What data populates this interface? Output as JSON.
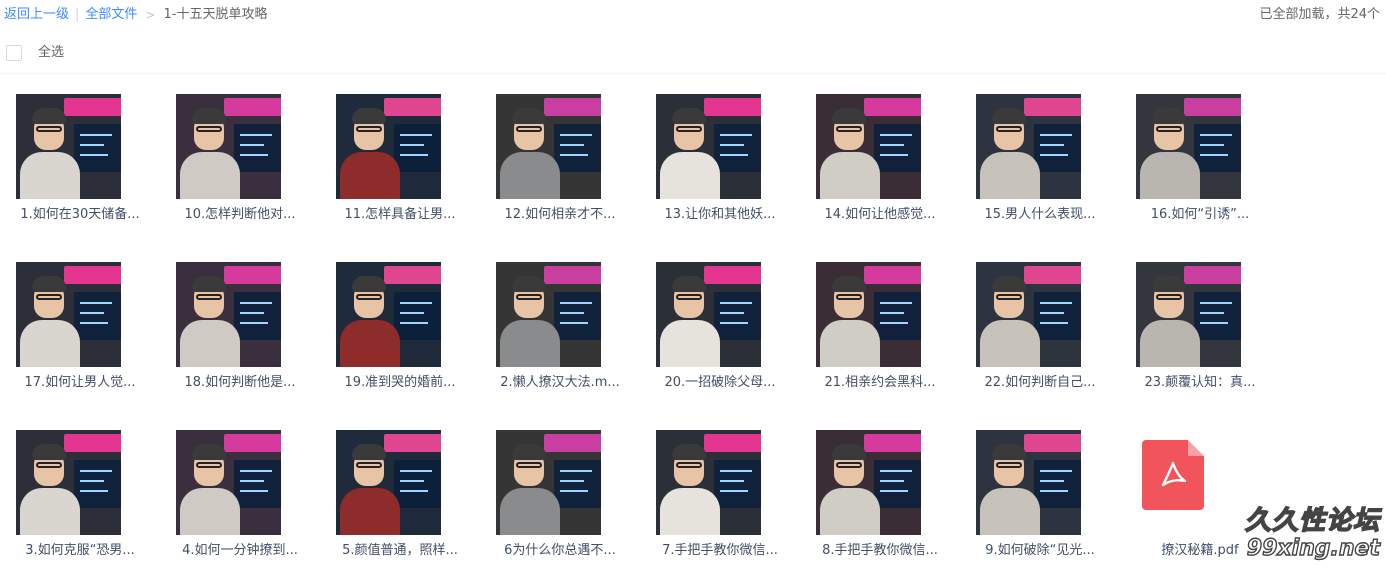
{
  "breadcrumb": {
    "back": "返回上一级",
    "separator": "|",
    "root": "全部文件",
    "arrow": ">",
    "current": "1-十五天脱单攻略"
  },
  "status": {
    "loaded": "已全部加载，共24个"
  },
  "select_all": {
    "label": "全选"
  },
  "files": [
    {
      "name": "1.如何在30天储备...",
      "type": "video"
    },
    {
      "name": "10.怎样判断他对...",
      "type": "video"
    },
    {
      "name": "11.怎样具备让男...",
      "type": "video"
    },
    {
      "name": "12.如何相亲才不...",
      "type": "video"
    },
    {
      "name": "13.让你和其他妖...",
      "type": "video"
    },
    {
      "name": "14.如何让他感觉...",
      "type": "video"
    },
    {
      "name": "15.男人什么表现...",
      "type": "video"
    },
    {
      "name": "16.如何“引诱”...",
      "type": "video"
    },
    {
      "name": "17.如何让男人觉...",
      "type": "video"
    },
    {
      "name": "18.如何判断他是...",
      "type": "video"
    },
    {
      "name": "19.准到哭的婚前...",
      "type": "video"
    },
    {
      "name": "2.懒人撩汉大法.m...",
      "type": "video"
    },
    {
      "name": "20.一招破除父母...",
      "type": "video"
    },
    {
      "name": "21.相亲约会黑科...",
      "type": "video"
    },
    {
      "name": "22.如何判断自己...",
      "type": "video"
    },
    {
      "name": "23.颠覆认知：真...",
      "type": "video"
    },
    {
      "name": "3.如何克服“恐男...",
      "type": "video"
    },
    {
      "name": "4.如何一分钟撩到...",
      "type": "video"
    },
    {
      "name": "5.颜值普通，照样...",
      "type": "video"
    },
    {
      "name": "6为什么你总遇不...",
      "type": "video"
    },
    {
      "name": "7.手把手教你微信...",
      "type": "video"
    },
    {
      "name": "8.手把手教你微信...",
      "type": "video"
    },
    {
      "name": "9.如何破除“见光...",
      "type": "video"
    },
    {
      "name": "撩汉秘籍.pdf",
      "type": "pdf"
    }
  ],
  "watermark": {
    "cn": "久久性论坛",
    "en": "99xing.net"
  },
  "colors": {
    "link": "#3b8cff",
    "text": "#424e67",
    "pdf": "#f2545b"
  },
  "icons": {
    "checkbox": "checkbox-icon",
    "pdf": "pdf-file-icon"
  }
}
